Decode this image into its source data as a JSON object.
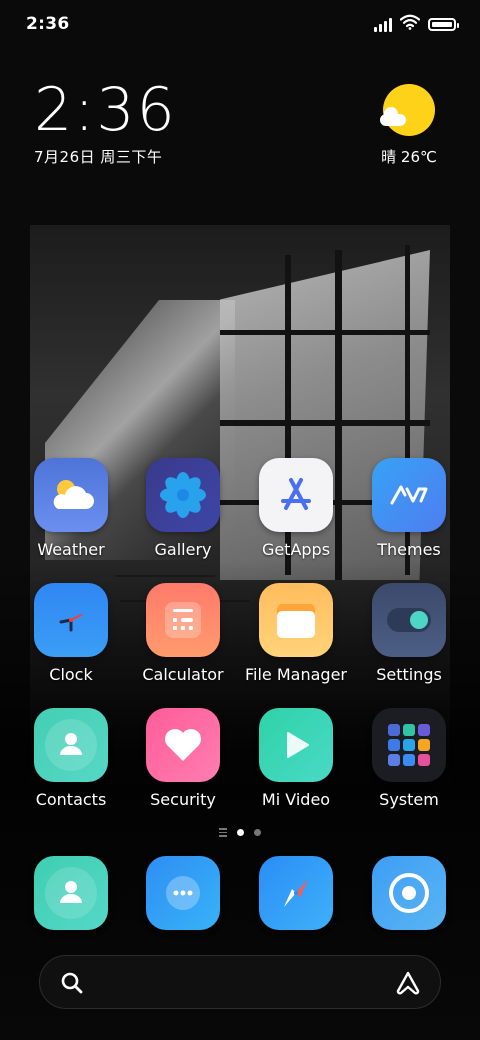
{
  "status_bar": {
    "time": "2:36",
    "icons": [
      "signal-icon",
      "wifi-icon",
      "battery-icon"
    ],
    "battery_level": 1.0
  },
  "clock_widget": {
    "time": "2:36",
    "date": "7月26日 周三下午"
  },
  "weather_widget": {
    "condition_icon": "sun-cloud-icon",
    "text": "晴 26℃"
  },
  "apps": [
    {
      "label": "Weather",
      "icon": "weather-icon"
    },
    {
      "label": "Gallery",
      "icon": "gallery-icon"
    },
    {
      "label": "GetApps",
      "icon": "getapps-icon"
    },
    {
      "label": "Themes",
      "icon": "themes-icon"
    },
    {
      "label": "Clock",
      "icon": "clock-icon"
    },
    {
      "label": "Calculator",
      "icon": "calculator-icon"
    },
    {
      "label": "File Manager",
      "icon": "file-manager-icon"
    },
    {
      "label": "Settings",
      "icon": "settings-icon"
    },
    {
      "label": "Contacts",
      "icon": "contacts-icon"
    },
    {
      "label": "Security",
      "icon": "security-icon"
    },
    {
      "label": "Mi Video",
      "icon": "mi-video-icon"
    },
    {
      "label": "System",
      "icon": "system-folder-icon"
    }
  ],
  "page_indicator": {
    "pages": 2,
    "current": 1
  },
  "dock": [
    {
      "icon": "phone-icon"
    },
    {
      "icon": "messages-icon"
    },
    {
      "icon": "browser-icon"
    },
    {
      "icon": "camera-icon"
    }
  ],
  "search_bar": {
    "left_icon": "search-icon",
    "right_icon": "assistant-icon"
  },
  "colors": {
    "sun": "#ffd21a",
    "background": "#0b0b0b"
  }
}
